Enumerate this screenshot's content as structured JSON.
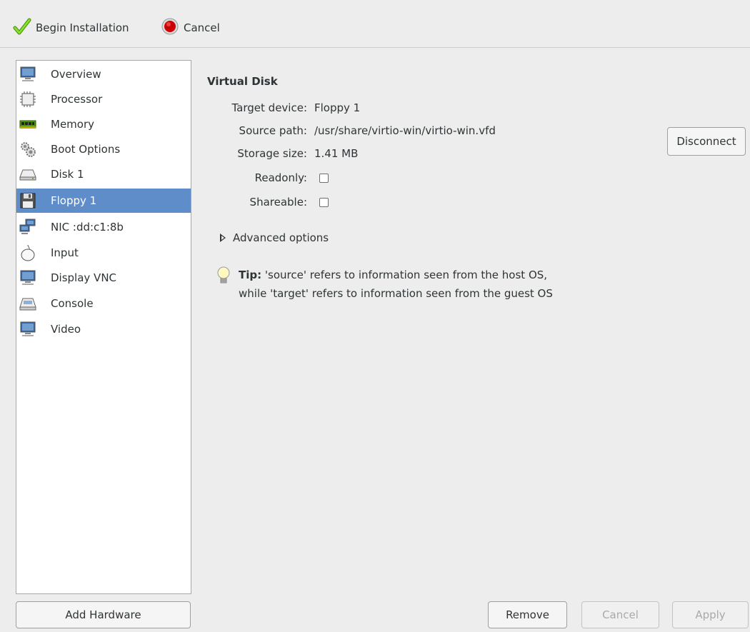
{
  "toolbar": {
    "begin_label": "Begin Installation",
    "cancel_label": "Cancel",
    "begin_icon": "check-icon",
    "cancel_icon": "stop-icon"
  },
  "sidebar": {
    "items": [
      {
        "label": "Overview",
        "icon": "monitor-icon"
      },
      {
        "label": "Processor",
        "icon": "cpu-icon"
      },
      {
        "label": "Memory",
        "icon": "memory-icon"
      },
      {
        "label": "Boot Options",
        "icon": "gears-icon"
      },
      {
        "label": "Disk 1",
        "icon": "disk-icon"
      },
      {
        "label": "Floppy 1",
        "icon": "floppy-icon",
        "selected": true
      },
      {
        "label": "NIC :dd:c1:8b",
        "icon": "network-icon"
      },
      {
        "label": "Input",
        "icon": "mouse-icon"
      },
      {
        "label": "Display VNC",
        "icon": "display-icon"
      },
      {
        "label": "Console",
        "icon": "console-icon"
      },
      {
        "label": "Video",
        "icon": "video-icon"
      }
    ],
    "add_hardware_label": "Add Hardware"
  },
  "details": {
    "title": "Virtual Disk",
    "target_device_label": "Target device:",
    "target_device_value": "Floppy 1",
    "source_path_label": "Source path:",
    "source_path_value": "/usr/share/virtio-win/virtio-win.vfd",
    "storage_size_label": "Storage size:",
    "storage_size_value": "1.41 MB",
    "readonly_label": "Readonly:",
    "readonly_checked": false,
    "shareable_label": "Shareable:",
    "shareable_checked": false,
    "disconnect_label": "Disconnect",
    "advanced_label": "Advanced options",
    "tip_bold": "Tip:",
    "tip_line1": " 'source' refers to information seen from the host OS,",
    "tip_line2": "while 'target' refers to information seen from the guest OS"
  },
  "footer": {
    "remove_label": "Remove",
    "cancel_label": "Cancel",
    "apply_label": "Apply"
  },
  "colors": {
    "selection": "#5f8dc9",
    "background": "#ededed"
  }
}
